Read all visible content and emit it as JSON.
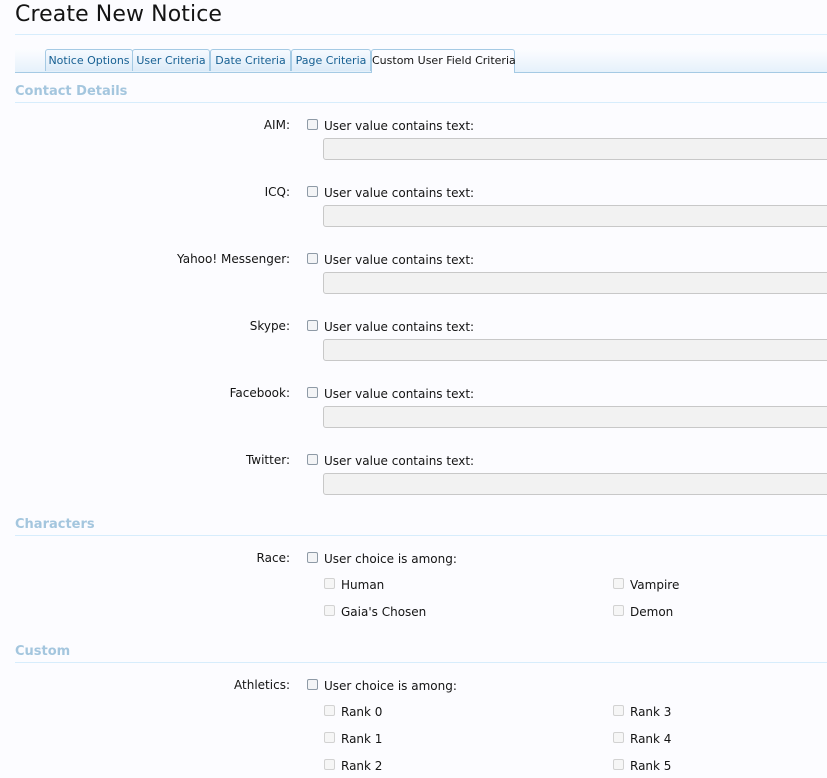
{
  "page": {
    "title": "Create New Notice"
  },
  "tabs": [
    {
      "label": "Notice Options"
    },
    {
      "label": "User Criteria"
    },
    {
      "label": "Date Criteria"
    },
    {
      "label": "Page Criteria"
    },
    {
      "label": "Custom User Field Criteria",
      "active": true
    }
  ],
  "sections": {
    "contact": {
      "title": "Contact Details",
      "fields": [
        {
          "label": "AIM:",
          "checkbox_label": "User value contains text:",
          "value": ""
        },
        {
          "label": "ICQ:",
          "checkbox_label": "User value contains text:",
          "value": ""
        },
        {
          "label": "Yahoo! Messenger:",
          "checkbox_label": "User value contains text:",
          "value": ""
        },
        {
          "label": "Skype:",
          "checkbox_label": "User value contains text:",
          "value": ""
        },
        {
          "label": "Facebook:",
          "checkbox_label": "User value contains text:",
          "value": ""
        },
        {
          "label": "Twitter:",
          "checkbox_label": "User value contains text:",
          "value": ""
        }
      ]
    },
    "characters": {
      "title": "Characters",
      "race": {
        "label": "Race:",
        "checkbox_label": "User choice is among:",
        "choices": [
          "Human",
          "Vampire",
          "Gaia's Chosen",
          "Demon"
        ]
      }
    },
    "custom": {
      "title": "Custom",
      "athletics": {
        "label": "Athletics:",
        "checkbox_label": "User choice is among:",
        "choices": [
          "Rank 0",
          "Rank 3",
          "Rank 1",
          "Rank 4",
          "Rank 2",
          "Rank 5"
        ]
      }
    }
  }
}
